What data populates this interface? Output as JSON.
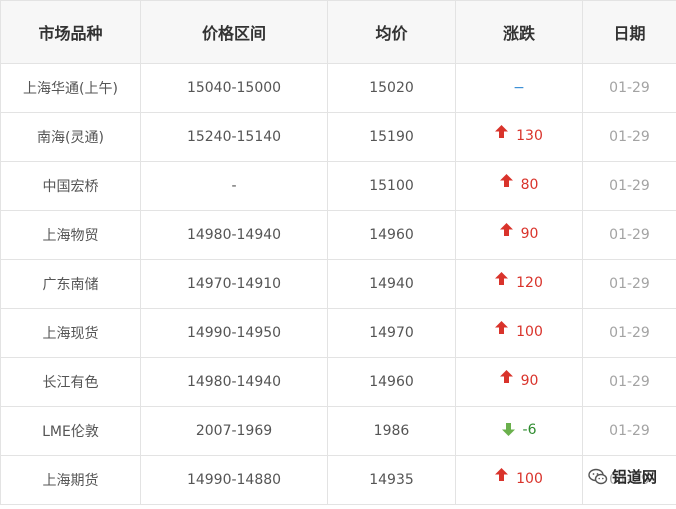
{
  "table": {
    "headers": [
      "市场品种",
      "价格区间",
      "均价",
      "涨跌",
      "日期"
    ],
    "rows": [
      {
        "market": "上海华通(上午)",
        "range": "15040-15000",
        "avg": "15020",
        "dir": "flat",
        "change": "−",
        "date": "01-29"
      },
      {
        "market": "南海(灵通)",
        "range": "15240-15140",
        "avg": "15190",
        "dir": "up",
        "change": "130",
        "date": "01-29"
      },
      {
        "market": "中国宏桥",
        "range": "-",
        "avg": "15100",
        "dir": "up",
        "change": "80",
        "date": "01-29"
      },
      {
        "market": "上海物贸",
        "range": "14980-14940",
        "avg": "14960",
        "dir": "up",
        "change": "90",
        "date": "01-29"
      },
      {
        "market": "广东南储",
        "range": "14970-14910",
        "avg": "14940",
        "dir": "up",
        "change": "120",
        "date": "01-29"
      },
      {
        "market": "上海现货",
        "range": "14990-14950",
        "avg": "14970",
        "dir": "up",
        "change": "100",
        "date": "01-29"
      },
      {
        "market": "长江有色",
        "range": "14980-14940",
        "avg": "14960",
        "dir": "up",
        "change": "90",
        "date": "01-29"
      },
      {
        "market": "LME伦敦",
        "range": "2007-1969",
        "avg": "1986",
        "dir": "down",
        "change": "-6",
        "date": "01-29"
      },
      {
        "market": "上海期货",
        "range": "14990-14880",
        "avg": "14935",
        "dir": "up",
        "change": "100",
        "date": "01-29"
      }
    ]
  },
  "colors": {
    "up": "#d9332b",
    "down": "#2e8b2e",
    "flat": "#3a8fd6"
  },
  "watermark": {
    "text": "铝道网",
    "icon": "wechat-icon"
  }
}
